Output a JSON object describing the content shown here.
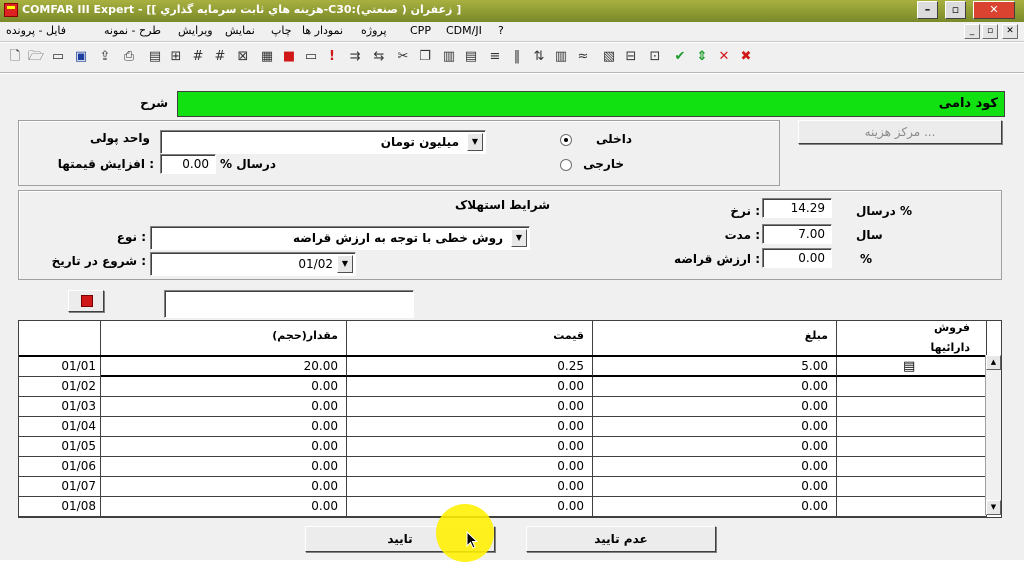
{
  "window": {
    "title": "COMFAR III Expert - [[ هزينه هاي ثابت سرمايه گذاري-C30:زعفران ( صنعتي) ]",
    "minimize": "–",
    "maximize": "▫",
    "close": "✕"
  },
  "menu": {
    "items": [
      "فایل - پرونده",
      "طرح - نمونه",
      "ویرایش",
      "نمایش",
      "چاپ",
      "نمودار ها",
      "پروژه",
      "CPP",
      "CDM/JI",
      "?"
    ]
  },
  "child_controls": [
    "_",
    "▫",
    "✕"
  ],
  "toolbar": {
    "icons": [
      "new-file",
      "open-folder",
      "folder",
      "save",
      "export",
      "print",
      "calculator-sheet",
      "grid-plus",
      "hash",
      "grid-x",
      "table",
      "calculator",
      "note",
      "alert",
      "connect",
      "link",
      "scissors",
      "copy",
      "paste",
      "clipboard",
      "lines",
      "bars",
      "sort",
      "chart",
      "wave",
      "grid-a",
      "grid-b",
      "grid-c",
      "check",
      "up-down",
      "x",
      "x-red"
    ]
  },
  "form": {
    "code_label": "کود دامی",
    "desc_label": "شرح",
    "cost_center_button": "... مرکز هزینه",
    "domestic_label": "داخلی",
    "foreign_label": "خارجی",
    "currency_label": "واحد پولی",
    "currency_value": "میلیون تومان",
    "price_increase_label": ": افزایش قیمتها",
    "percent_annual": "درسال %",
    "price_increase_value": "0.00",
    "depreciation_title": "شرایط استهلاک",
    "rate_label": ": نرخ",
    "rate_value": "14.29",
    "rate_unit": "% درسال",
    "duration_label": ": مدت",
    "duration_value": "7.00",
    "duration_unit": "سال",
    "salvage_label": ": ارزش قراضه",
    "salvage_value": "0.00",
    "salvage_unit": "%",
    "type_label": ": نوع",
    "type_value": "روش خطی با توجه به ارزش قراضه",
    "start_label": ": شروع در تاریخ",
    "start_value": "01/02"
  },
  "grid": {
    "headers": {
      "col1": "مقدار(حجم)",
      "col2": "قیمت",
      "col3": "مبلغ",
      "col4_line1": "فروش",
      "col4_line2": "دارائیها"
    },
    "rows": [
      {
        "period": "01/01",
        "qty": "20.00",
        "price": "0.25",
        "amount": "5.00"
      },
      {
        "period": "01/02",
        "qty": "0.00",
        "price": "0.00",
        "amount": "0.00"
      },
      {
        "period": "01/03",
        "qty": "0.00",
        "price": "0.00",
        "amount": "0.00"
      },
      {
        "period": "01/04",
        "qty": "0.00",
        "price": "0.00",
        "amount": "0.00"
      },
      {
        "period": "01/05",
        "qty": "0.00",
        "price": "0.00",
        "amount": "0.00"
      },
      {
        "period": "01/06",
        "qty": "0.00",
        "price": "0.00",
        "amount": "0.00"
      },
      {
        "period": "01/07",
        "qty": "0.00",
        "price": "0.00",
        "amount": "0.00"
      },
      {
        "period": "01/08",
        "qty": "0.00",
        "price": "0.00",
        "amount": "0.00"
      }
    ]
  },
  "buttons": {
    "ok": "تایید",
    "cancel": "عدم تایید"
  },
  "colors": {
    "accent_green": "#11e011",
    "titlebar": "#8a9a30"
  }
}
